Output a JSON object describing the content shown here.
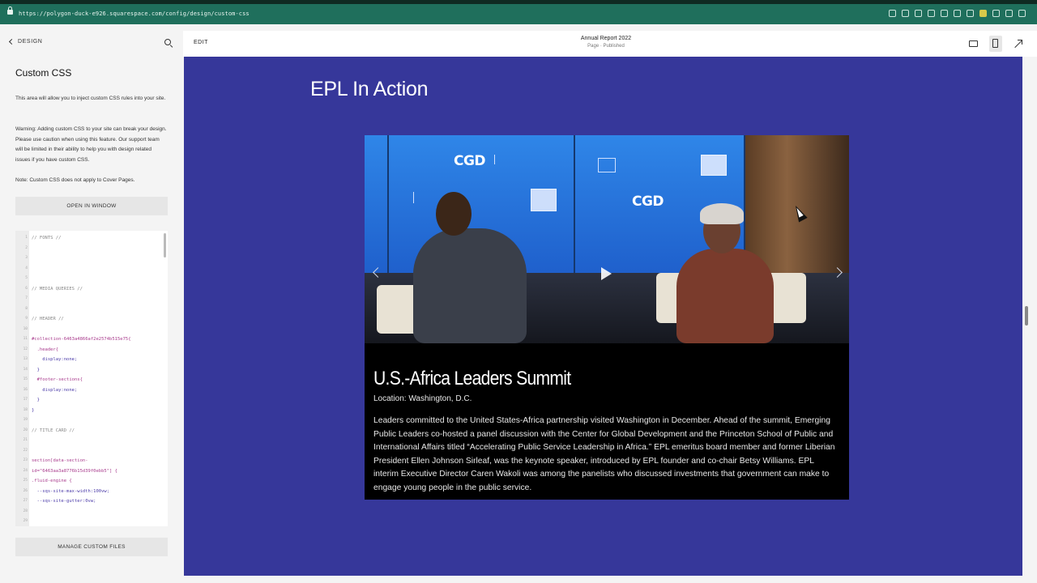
{
  "browser": {
    "url": "https://polygon-duck-e926.squarespace.com/config/design/custom-css"
  },
  "sidebar": {
    "back_label": "DESIGN",
    "title": "Custom CSS",
    "intro": "This area will allow you to inject custom CSS rules into your site.",
    "warning": "Warning: Adding custom CSS to your site can break your design. Please use caution when using this feature. Our support team will be limited in their ability to help you with design related issues if you have custom CSS.",
    "note": "Note: Custom CSS does not apply to Cover Pages.",
    "open_window_label": "OPEN IN WINDOW",
    "manage_files_label": "MANAGE CUSTOM FILES"
  },
  "editor": {
    "lines": [
      {
        "n": "1",
        "t": "// FONTS //",
        "k": "comment"
      },
      {
        "n": "2",
        "t": "",
        "k": "comment"
      },
      {
        "n": "3",
        "t": "",
        "k": "comment"
      },
      {
        "n": "4",
        "t": "",
        "k": "comment"
      },
      {
        "n": "5",
        "t": "",
        "k": "comment"
      },
      {
        "n": "6",
        "t": "// MEDIA QUERIES //",
        "k": "comment"
      },
      {
        "n": "7",
        "t": "",
        "k": "comment"
      },
      {
        "n": "8",
        "t": "",
        "k": "comment"
      },
      {
        "n": "9",
        "t": "// HEADER //",
        "k": "comment"
      },
      {
        "n": "10",
        "t": "",
        "k": "comment"
      },
      {
        "n": "11",
        "t": "#collection-6463a4866af2e2574b515e75{",
        "k": "sel"
      },
      {
        "n": "12",
        "t": "  .header{",
        "k": "sel"
      },
      {
        "n": "13",
        "t": "    display:none;",
        "k": "prop"
      },
      {
        "n": "14",
        "t": "  }",
        "k": "prop"
      },
      {
        "n": "15",
        "t": "  #footer-sections{",
        "k": "sel"
      },
      {
        "n": "16",
        "t": "    display:none;",
        "k": "prop"
      },
      {
        "n": "17",
        "t": "  }",
        "k": "prop"
      },
      {
        "n": "18",
        "t": "}",
        "k": "prop"
      },
      {
        "n": "19",
        "t": "",
        "k": "comment"
      },
      {
        "n": "20",
        "t": "// TITLE CARD //",
        "k": "comment"
      },
      {
        "n": "21",
        "t": "",
        "k": "comment"
      },
      {
        "n": "22",
        "t": "",
        "k": "comment"
      },
      {
        "n": "23",
        "t": "section[data-section-",
        "k": "sel"
      },
      {
        "n": "24",
        "t": "id=\"6463aa3a8776b15d39f0ebb5\"] {",
        "k": "sel"
      },
      {
        "n": "25",
        "t": ".fluid-engine {",
        "k": "sel"
      },
      {
        "n": "26",
        "t": "  --sqs-site-max-width:100vw;",
        "k": "prop"
      },
      {
        "n": "27",
        "t": "  --sqs-site-gutter:0vw;",
        "k": "prop"
      },
      {
        "n": "28",
        "t": "",
        "k": "prop"
      },
      {
        "n": "29",
        "t": "",
        "k": "prop"
      },
      {
        "n": "30",
        "t": "}",
        "k": "prop"
      },
      {
        "n": "31",
        "t": "}",
        "k": "prop"
      }
    ]
  },
  "topbar": {
    "edit_label": "EDIT",
    "doc_title": "Annual Report 2022",
    "doc_subtitle": "Page · Published"
  },
  "preview": {
    "heading": "EPL In Action",
    "slide": {
      "screen_logos": [
        "CGD",
        "CGD"
      ],
      "title": "U.S.-Africa Leaders Summit",
      "location": "Location: Washington, D.C.",
      "body": "Leaders committed to the United States-Africa partnership visited Washington in December. Ahead of the summit, Emerging Public Leaders co-hosted a panel discussion with the Center for Global Development and the Princeton School of Public and International Affairs titled “Accelerating Public Service Leadership in Africa.” EPL emeritus board member and former Liberian President Ellen Johnson Sirleaf, was the keynote speaker, introduced by EPL founder and co-chair Betsy Williams. EPL interim Executive Director Caren Wakoli was among the panelists who discussed investments that government can make to engage young people in the public service."
    }
  },
  "colors": {
    "browser_bar": "#1f6f5c",
    "section_bg": "#36379a",
    "caption_bg": "#000000"
  }
}
